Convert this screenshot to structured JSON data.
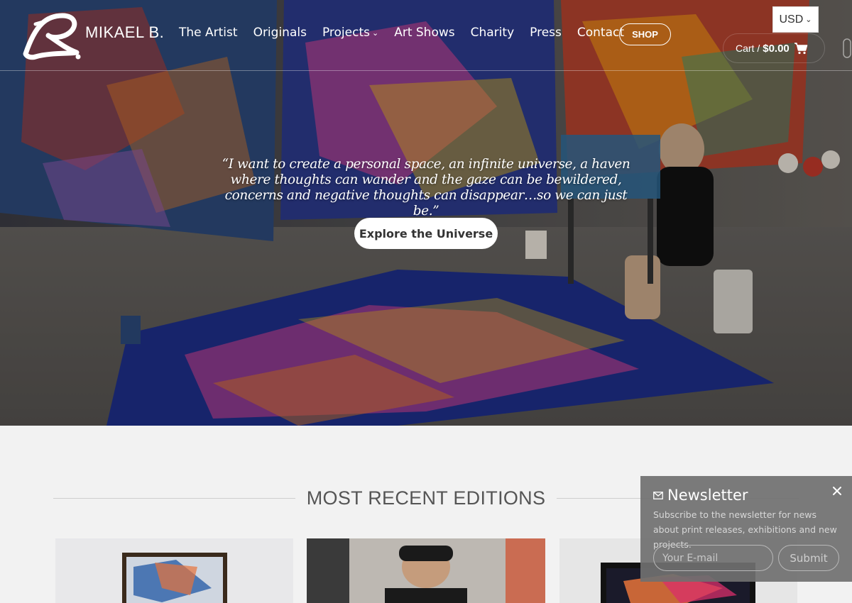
{
  "brand": {
    "name": "MIKAEL B."
  },
  "nav": {
    "items": [
      {
        "label": "The Artist"
      },
      {
        "label": "Originals"
      },
      {
        "label": "Projects",
        "has_dropdown": true
      },
      {
        "label": "Art Shows"
      },
      {
        "label": "Charity"
      },
      {
        "label": "Press"
      },
      {
        "label": "Contact"
      }
    ],
    "shop_label": "SHOP"
  },
  "header": {
    "currency": "USD",
    "cart_label": "Cart /",
    "cart_total": "$0.00"
  },
  "hero": {
    "quote": "“I want to create a personal space, an infinite universe, a haven where thoughts can wander and the gaze can be bewildered, concerns and negative thoughts can disappear…so we can just be.”",
    "button_label": "Explore the Universe"
  },
  "main": {
    "section_title": "MOST RECENT EDITIONS"
  },
  "newsletter": {
    "title": "Newsletter",
    "description": "Subscribe to the newsletter for news about print releases, exhibitions and new projects.",
    "email_placeholder": "Your E-mail",
    "submit_label": "Submit"
  },
  "icons": {
    "cart": "cart-icon",
    "dropdown": "chevron-down-icon",
    "mail": "mail-icon",
    "close": "close-icon"
  }
}
